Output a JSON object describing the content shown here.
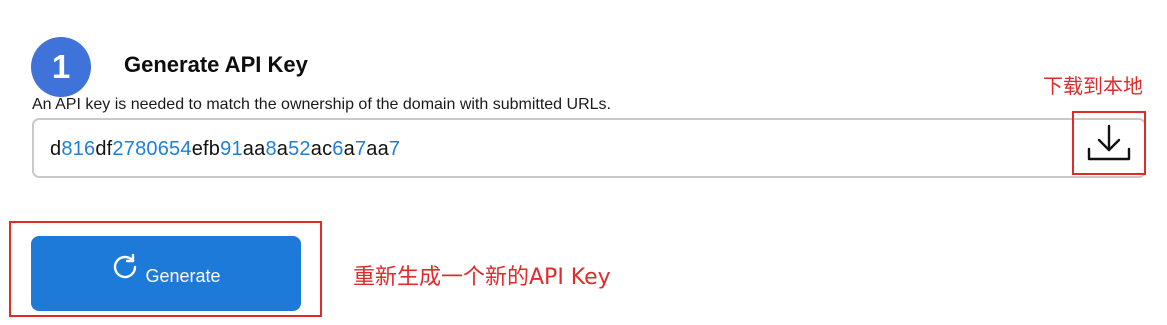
{
  "step": {
    "number": "1",
    "title": "Generate API Key",
    "description": "An API key is needed to match the ownership of the domain with submitted URLs."
  },
  "api_key": {
    "value": "d816df2780654efb91aa8a52ac6a7aa7"
  },
  "download": {
    "annotation": "下载到本地",
    "icon": "download-icon"
  },
  "generate": {
    "label": "Generate",
    "icon": "refresh-icon",
    "annotation": "重新生成一个新的API Key"
  },
  "colors": {
    "badge": "#3f73d9",
    "button": "#1d7ad9",
    "digit": "#1f7fd6",
    "annotation": "#e02b2b"
  }
}
